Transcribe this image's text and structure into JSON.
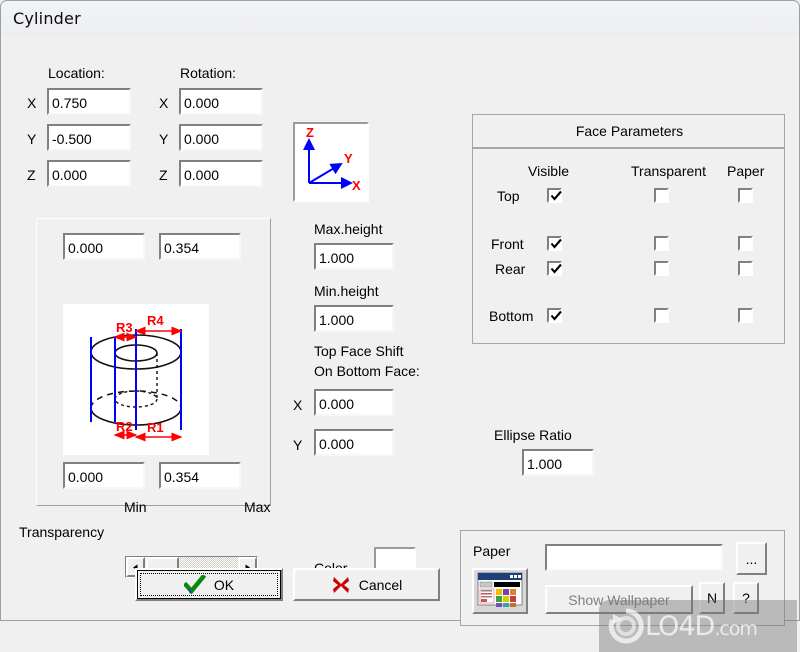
{
  "window": {
    "title": "Cylinder"
  },
  "location": {
    "label": "Location:",
    "axes": [
      {
        "name": "X",
        "value": "0.750"
      },
      {
        "name": "Y",
        "value": "-0.500"
      },
      {
        "name": "Z",
        "value": "0.000"
      }
    ]
  },
  "rotation": {
    "label": "Rotation:",
    "axes": [
      {
        "name": "X",
        "value": "0.000"
      },
      {
        "name": "Y",
        "value": "0.000"
      },
      {
        "name": "Z",
        "value": "0.000"
      }
    ]
  },
  "axis_widget": {
    "x": "X",
    "y": "Y",
    "z": "Z",
    "color_axis": "#0000ff",
    "color_label": "#ff0000"
  },
  "radii": {
    "top_left": "0.000",
    "top_right": "0.354",
    "bottom_left": "0.000",
    "bottom_right": "0.354",
    "diagram_labels": {
      "r1": "R1",
      "r2": "R2",
      "r3": "R3",
      "r4": "R4"
    }
  },
  "heights": {
    "max_label": "Max.height",
    "max_value": "1.000",
    "min_label": "Min.height",
    "min_value": "1.000"
  },
  "top_face_shift": {
    "line1": "Top Face Shift",
    "line2": "On Bottom Face:",
    "x_label": "X",
    "x_value": "0.000",
    "y_label": "Y",
    "y_value": "0.000"
  },
  "ellipse": {
    "label": "Ellipse Ratio",
    "value": "1.000"
  },
  "face_parameters": {
    "title": "Face Parameters",
    "columns": [
      "Visible",
      "Transparent",
      "Paper"
    ],
    "rows": [
      {
        "name": "Top",
        "visible": true,
        "transparent": false,
        "paper": false
      },
      {
        "name": "Front",
        "visible": true,
        "transparent": false,
        "paper": false
      },
      {
        "name": "Rear",
        "visible": true,
        "transparent": false,
        "paper": false
      },
      {
        "name": "Bottom",
        "visible": true,
        "transparent": false,
        "paper": false
      }
    ]
  },
  "transparency": {
    "label": "Transparency",
    "min_label": "Min",
    "max_label": "Max",
    "left_arrow": "◄",
    "right_arrow": "►"
  },
  "color": {
    "label": "Color",
    "value": "#ffffff"
  },
  "paper": {
    "label": "Paper",
    "path_value": "",
    "browse_label": "...",
    "show_wallpaper_label": "Show Wallpaper",
    "n_label": "N",
    "help_label": "?"
  },
  "buttons": {
    "ok": "OK",
    "cancel": "Cancel"
  },
  "watermark": {
    "text": "LO4D",
    "suffix": ".com"
  }
}
